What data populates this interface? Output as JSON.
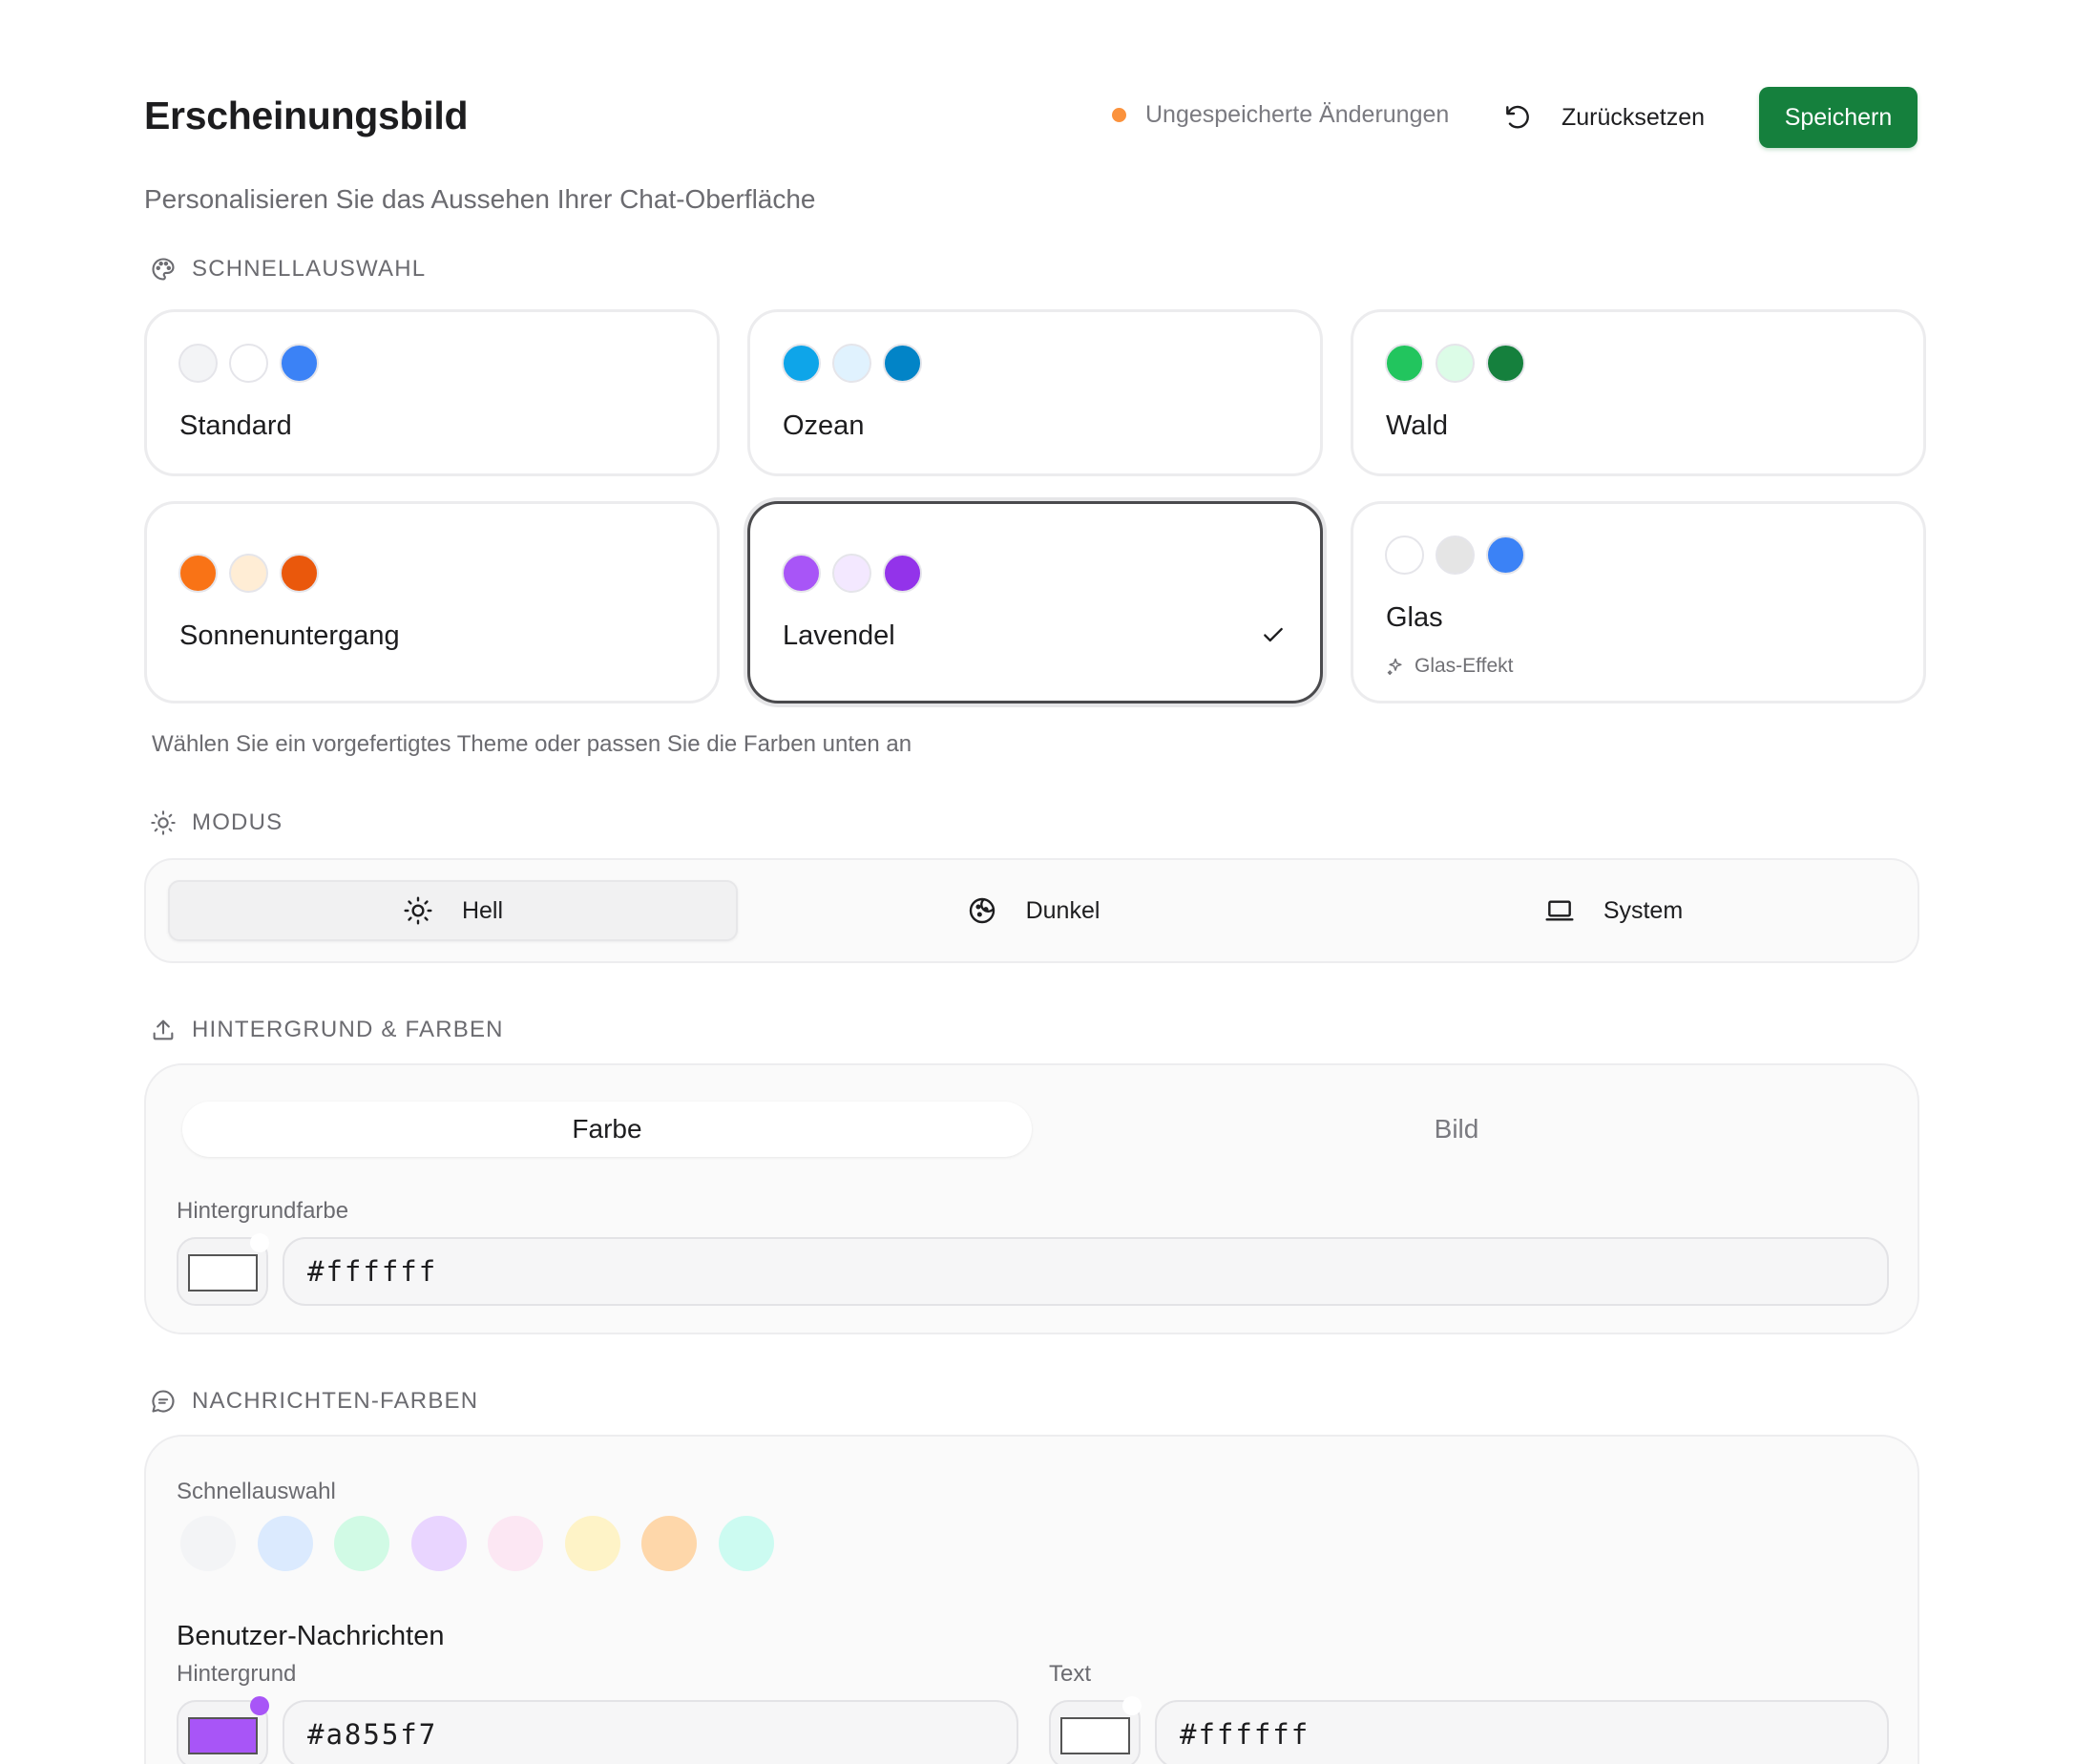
{
  "header": {
    "title": "Erscheinungsbild",
    "subtitle": "Personalisieren Sie das Aussehen Ihrer Chat-Oberfläche",
    "unsaved_label": "Ungespeicherte Änderungen",
    "reset_label": "Zurücksetzen",
    "save_label": "Speichern"
  },
  "quick_select": {
    "label": "SCHNELLAUSWAHL",
    "hint": "Wählen Sie ein vorgefertigtes Theme oder passen Sie die Farben unten an",
    "themes": [
      {
        "name": "Standard",
        "colors": [
          "#f3f4f6",
          "#ffffff",
          "#3b82f6"
        ],
        "selected": false
      },
      {
        "name": "Ozean",
        "colors": [
          "#0ea5e9",
          "#e0f2fe",
          "#0284c7"
        ],
        "selected": false
      },
      {
        "name": "Wald",
        "colors": [
          "#22c55e",
          "#dcfce7",
          "#15803d"
        ],
        "selected": false
      },
      {
        "name": "Sonnenuntergang",
        "colors": [
          "#f97316",
          "#ffedd5",
          "#ea580c"
        ],
        "selected": false
      },
      {
        "name": "Lavendel",
        "colors": [
          "#a855f7",
          "#f3e8ff",
          "#9333ea"
        ],
        "selected": true
      },
      {
        "name": "Glas",
        "colors": [
          "#ffffff",
          "#e5e5e5",
          "#3b82f6"
        ],
        "selected": false,
        "badge": "Glas-Effekt"
      }
    ]
  },
  "mode": {
    "label": "MODUS",
    "options": [
      {
        "label": "Hell",
        "icon": "sun-icon",
        "active": true
      },
      {
        "label": "Dunkel",
        "icon": "moon-icon",
        "active": false
      },
      {
        "label": "System",
        "icon": "laptop-icon",
        "active": false
      }
    ]
  },
  "background": {
    "label": "HINTERGRUND & FARBEN",
    "tabs": [
      {
        "label": "Farbe",
        "active": true
      },
      {
        "label": "Bild",
        "active": false
      }
    ],
    "color_label": "Hintergrundfarbe",
    "color_value": "#ffffff"
  },
  "messages": {
    "label": "NACHRICHTEN-FARBEN",
    "quick_label": "Schnellauswahl",
    "quick_colors": [
      "#f3f4f6",
      "#dbeafe",
      "#d1fae5",
      "#e9d5ff",
      "#fce7f3",
      "#fef3c7",
      "#fed7aa",
      "#ccfbf1"
    ],
    "user_heading": "Benutzer-Nachrichten",
    "bg_label": "Hintergrund",
    "bg_value": "#a855f7",
    "text_label": "Text",
    "text_value": "#ffffff"
  },
  "colors": {
    "accent_save": "#15803d",
    "unsaved_dot": "#fb923c"
  }
}
